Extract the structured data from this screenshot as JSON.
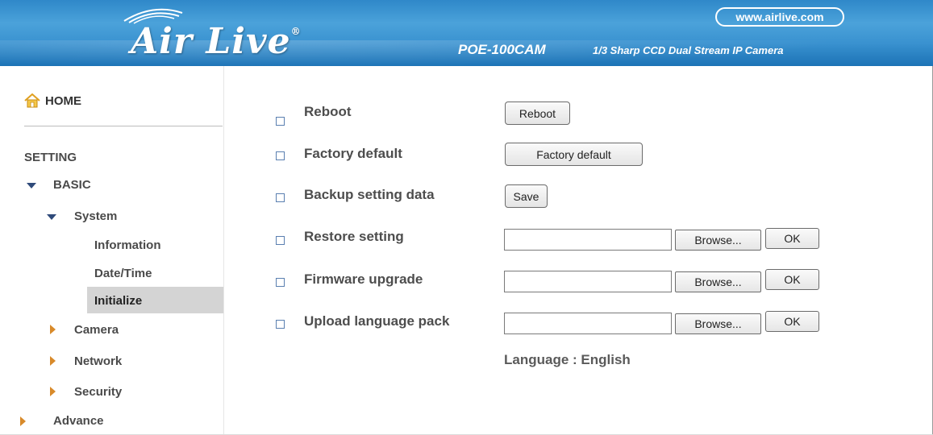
{
  "header": {
    "logo_text": "Air Live",
    "logo_reg": "®",
    "site": "www.airlive.com",
    "model": "POE-100CAM",
    "model_desc": "1/3 Sharp CCD Dual Stream IP Camera"
  },
  "sidebar": {
    "home": "HOME",
    "setting": "SETTING",
    "basic": "BASIC",
    "system": "System",
    "information": "Information",
    "datetime": "Date/Time",
    "initialize": "Initialize",
    "camera": "Camera",
    "network": "Network",
    "security": "Security",
    "advance": "Advance"
  },
  "content": {
    "reboot_label": "Reboot",
    "reboot_button": "Reboot",
    "factory_label": "Factory default",
    "factory_button": "Factory default",
    "backup_label": "Backup setting data",
    "save_button": "Save",
    "restore_label": "Restore setting",
    "firmware_label": "Firmware upgrade",
    "language_pack_label": "Upload language pack",
    "browse_label": "Browse...",
    "ok_label": "OK",
    "language": "Language : English"
  },
  "colors": {
    "header_blue": "#2f88c9",
    "arrow_open": "#2f4a7a",
    "arrow_closed": "#d88a2a",
    "active_bg": "#d4d4d4"
  }
}
